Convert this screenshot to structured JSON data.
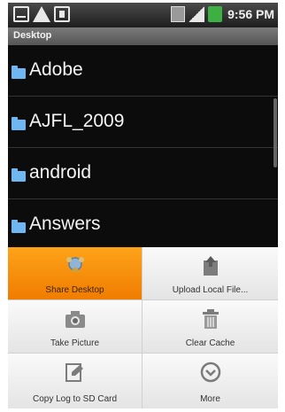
{
  "status_bar": {
    "left_icons": [
      "voicemail-icon",
      "warning-icon",
      "usb-icon"
    ],
    "right_icons": [
      "sim-icon",
      "signal-icon",
      "battery-icon"
    ],
    "time": "9:56 PM"
  },
  "title_bar": {
    "title": "Desktop"
  },
  "file_list": {
    "items": [
      {
        "label": "Adobe",
        "icon": "folder-icon"
      },
      {
        "label": "AJFL_2009",
        "icon": "folder-icon"
      },
      {
        "label": "android",
        "icon": "folder-icon"
      },
      {
        "label": "Answers",
        "icon": "folder-icon"
      }
    ]
  },
  "menu": {
    "items": [
      {
        "label": "Share Desktop",
        "icon": "share-icon",
        "selected": true
      },
      {
        "label": "Upload Local File...",
        "icon": "upload-icon",
        "selected": false
      },
      {
        "label": "Take Picture",
        "icon": "camera-icon",
        "selected": false
      },
      {
        "label": "Clear Cache",
        "icon": "trash-icon",
        "selected": false
      },
      {
        "label": "Copy Log to SD Card",
        "icon": "copy-log-icon",
        "selected": false
      },
      {
        "label": "More",
        "icon": "more-icon",
        "selected": false
      }
    ]
  },
  "colors": {
    "highlight": "#f58a00",
    "folder": "#6fb7f2",
    "list_background": "#0c0c0c",
    "menu_background": "#f1f1f1"
  }
}
